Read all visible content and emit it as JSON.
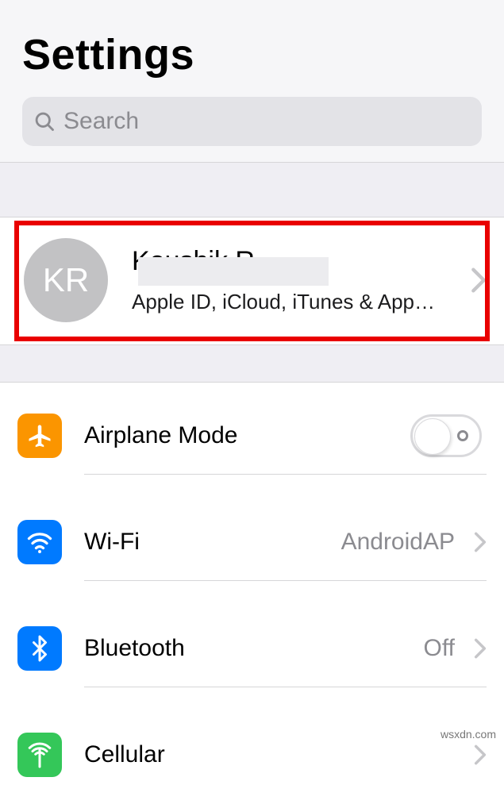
{
  "header": {
    "title": "Settings",
    "search_placeholder": "Search"
  },
  "profile": {
    "initials": "KR",
    "name": "Koushik R",
    "subtitle": "Apple ID, iCloud, iTunes & App…"
  },
  "rows": {
    "airplane": {
      "label": "Airplane Mode",
      "enabled": false
    },
    "wifi": {
      "label": "Wi-Fi",
      "value": "AndroidAP"
    },
    "bluetooth": {
      "label": "Bluetooth",
      "value": "Off"
    },
    "cellular": {
      "label": "Cellular"
    }
  },
  "watermark": "wsxdn.com"
}
